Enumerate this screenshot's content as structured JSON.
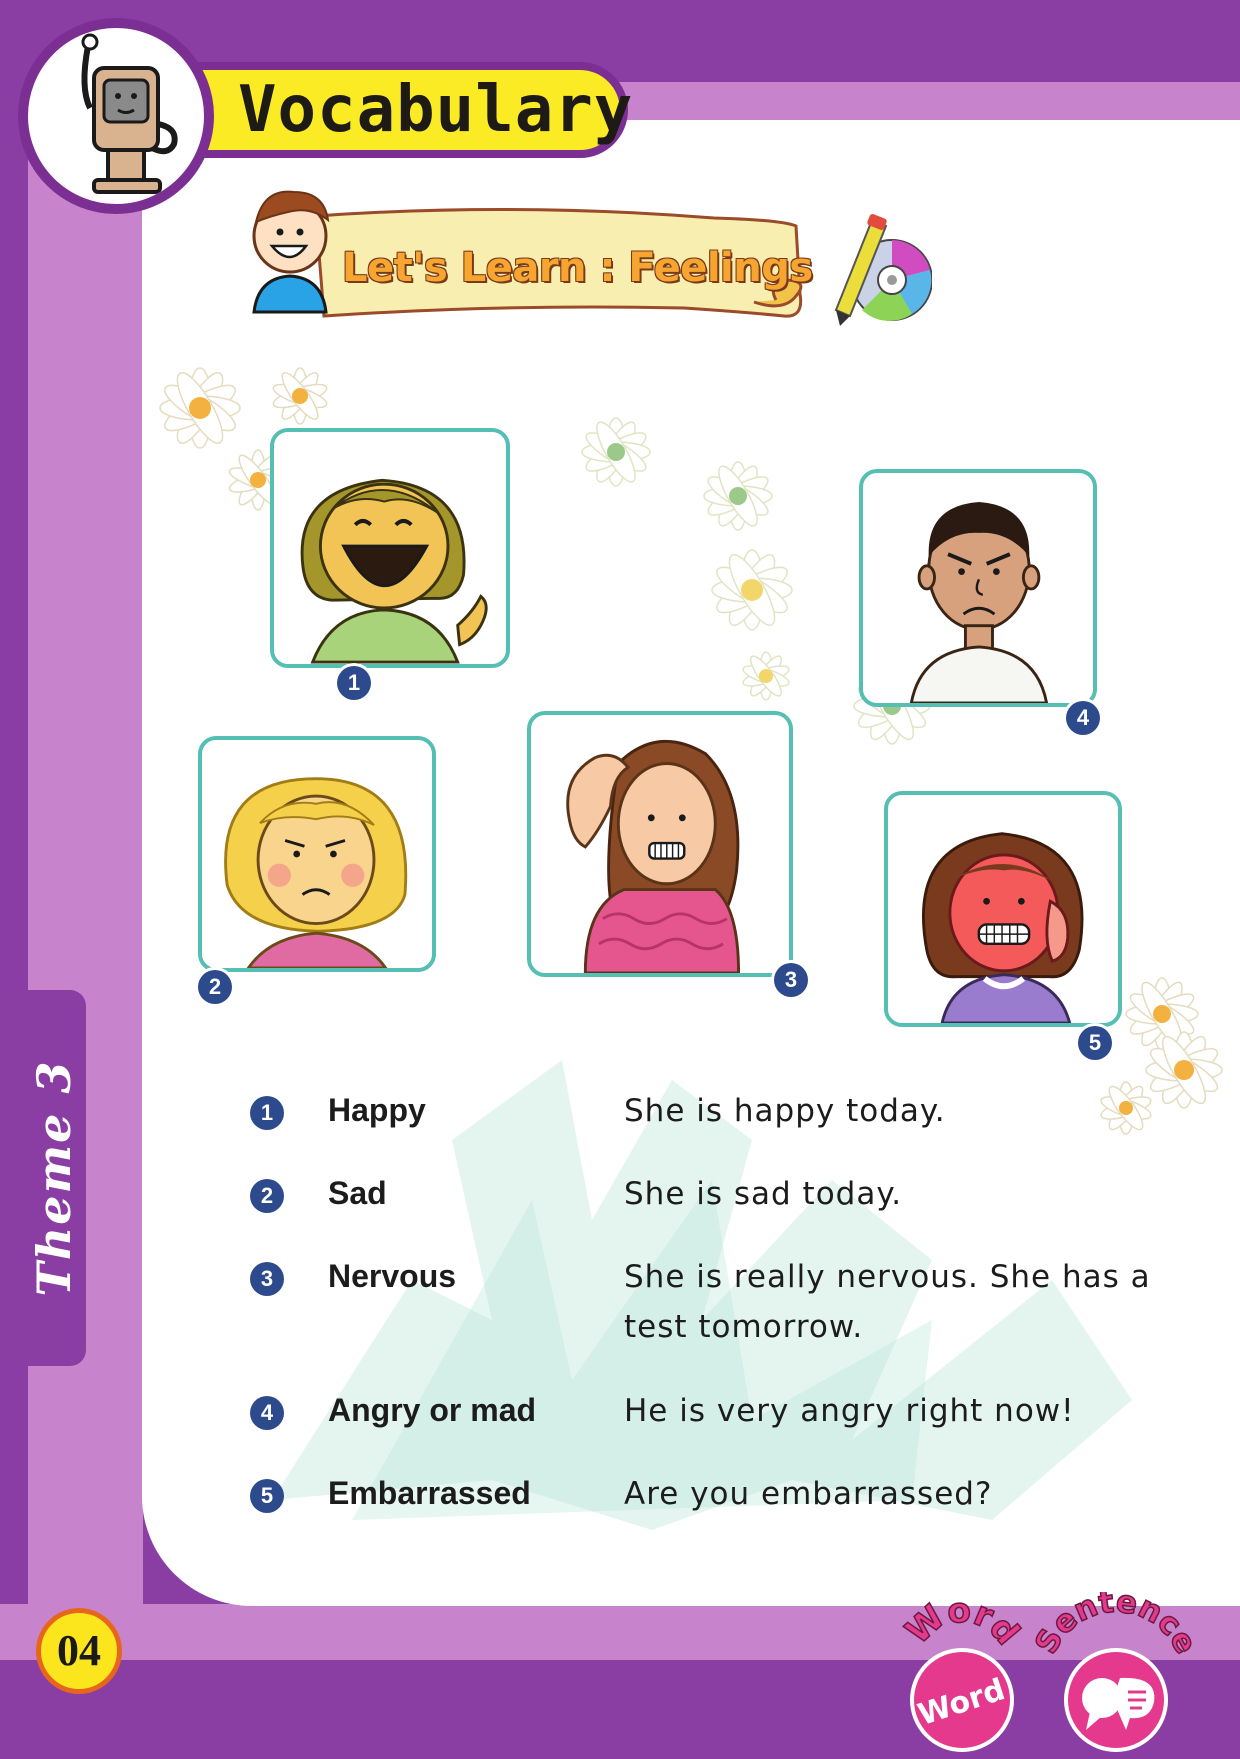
{
  "header": {
    "title": "Vocabulary",
    "mascot_icon": "computer-mascot-icon"
  },
  "banner": {
    "title": "Let's Learn : Feelings",
    "cd_icon": "cd-pencil-icon"
  },
  "pictures": [
    {
      "number": "1",
      "feeling": "happy"
    },
    {
      "number": "2",
      "feeling": "sad"
    },
    {
      "number": "3",
      "feeling": "nervous"
    },
    {
      "number": "4",
      "feeling": "angry"
    },
    {
      "number": "5",
      "feeling": "embarrassed"
    }
  ],
  "vocabulary": [
    {
      "number": "1",
      "word": "Happy",
      "sentence": "She is happy today."
    },
    {
      "number": "2",
      "word": "Sad",
      "sentence": "She is sad today."
    },
    {
      "number": "3",
      "word": "Nervous",
      "sentence": "She is really nervous. She has a test tomorrow."
    },
    {
      "number": "4",
      "word": "Angry or mad",
      "sentence": "He is very angry right now!"
    },
    {
      "number": "5",
      "word": "Embarrassed",
      "sentence": "Are you embarrassed?"
    }
  ],
  "sidebar": {
    "theme_label": "Theme 3"
  },
  "footer": {
    "page_number": "04",
    "logos": [
      {
        "arc_text": "Word",
        "inner_text": "Word"
      },
      {
        "arc_text": "Sentence",
        "inner_text": ""
      }
    ]
  },
  "colors": {
    "purple": "#8a3ea3",
    "lilac": "#c783cc",
    "yellow": "#fbeb25",
    "teal": "#55bfb4",
    "navy": "#2d4a8c",
    "pink": "#e4398c"
  }
}
